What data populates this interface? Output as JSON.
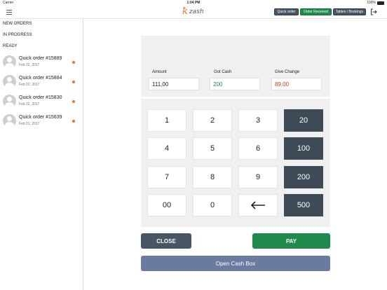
{
  "statusbar": {
    "carrier": "Carrier",
    "time": "1:04 PM",
    "battery": "100%"
  },
  "header": {
    "logo_text": "zash",
    "buttons": {
      "quick_order": "Quick order",
      "order_received": "Order Received",
      "tables_bookings": "Tables / Bookings"
    }
  },
  "sidebar": {
    "sections": {
      "new_orders": "NEW ORDERS",
      "in_progress": "IN PROGRESS",
      "ready": "READY"
    },
    "orders": [
      {
        "title": "Quick order #15889",
        "date": "Feb 22, 2017"
      },
      {
        "title": "Quick order #15884",
        "date": "Feb 22, 2017"
      },
      {
        "title": "Quick order #15830",
        "date": "Feb 22, 2017"
      },
      {
        "title": "Quick order #15639",
        "date": "Feb 21, 2017"
      }
    ]
  },
  "payment": {
    "amount": {
      "label": "Amount",
      "value": "111,00"
    },
    "got_cash": {
      "label": "Got Cash",
      "value": "200",
      "color": "#1f8a4c"
    },
    "give_change": {
      "label": "Give Change",
      "value": "89,00",
      "color": "#c0392b"
    }
  },
  "keypad": {
    "keys": [
      "1",
      "2",
      "3",
      "20",
      "4",
      "5",
      "6",
      "100",
      "7",
      "8",
      "9",
      "200",
      "00",
      "0",
      "",
      "500"
    ]
  },
  "actions": {
    "close": "CLOSE",
    "pay": "PAY",
    "open_cash_box": "Open Cash Box"
  },
  "colors": {
    "dark_key": "#3e4a56",
    "accent_green": "#1f8a4c",
    "cash_box": "#6b7aa1",
    "status_dot": "#e0733a"
  }
}
